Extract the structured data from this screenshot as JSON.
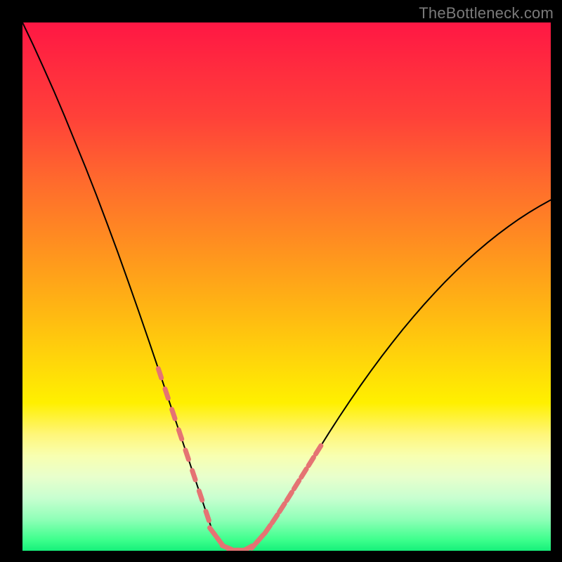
{
  "watermark": "TheBottleneck.com",
  "colors": {
    "frame": "#000000",
    "gradient_top": "#ff1744",
    "gradient_mid1": "#ff8f20",
    "gradient_mid2": "#fff000",
    "gradient_bottom": "#16f07a",
    "curve": "#000000",
    "marker": "#e57373"
  },
  "chart_data": {
    "type": "line",
    "title": "",
    "xlabel": "",
    "ylabel": "",
    "xlim": [
      0,
      100
    ],
    "ylim": [
      0,
      100
    ],
    "x": [
      0,
      2,
      4,
      6,
      8,
      10,
      12,
      14,
      16,
      18,
      20,
      22,
      24,
      26,
      28,
      29,
      30,
      31,
      32,
      33,
      34,
      35,
      36,
      38,
      40,
      42,
      44,
      46,
      48,
      50,
      52,
      54,
      56,
      58,
      60,
      62,
      64,
      66,
      68,
      70,
      72,
      74,
      76,
      78,
      80,
      82,
      84,
      86,
      88,
      90,
      92,
      94,
      96,
      98,
      100
    ],
    "y": [
      100,
      95.8,
      91.4,
      86.9,
      82.2,
      77.3,
      72.4,
      67.3,
      62.0,
      56.6,
      51.0,
      45.3,
      39.5,
      33.6,
      27.6,
      24.6,
      21.6,
      18.6,
      15.6,
      12.6,
      9.6,
      6.6,
      3.6,
      0.9,
      0.1,
      0.1,
      1.2,
      3.5,
      6.4,
      9.5,
      12.7,
      15.9,
      19.1,
      22.3,
      25.4,
      28.4,
      31.3,
      34.1,
      36.8,
      39.4,
      41.9,
      44.3,
      46.6,
      48.8,
      50.9,
      52.9,
      54.8,
      56.6,
      58.3,
      59.9,
      61.4,
      62.8,
      64.1,
      65.3,
      66.4
    ],
    "marker_clusters": [
      {
        "label": "left-arm-markers",
        "x_range": [
          26,
          35
        ],
        "count": 8
      },
      {
        "label": "valley-markers",
        "x_range": [
          36,
          44
        ],
        "count": 7
      },
      {
        "label": "right-arm-markers",
        "x_range": [
          45,
          56
        ],
        "count": 9
      }
    ],
    "notes": "V-shaped bottleneck curve. Minimum (~0) near x≈40. Left arm starts at 100 at x=0; right arm rises to ~66 at x=100. Salmon dashed markers cluster along both arms near the valley and along the valley floor. No axis ticks, labels, grid, or legend are shown."
  }
}
